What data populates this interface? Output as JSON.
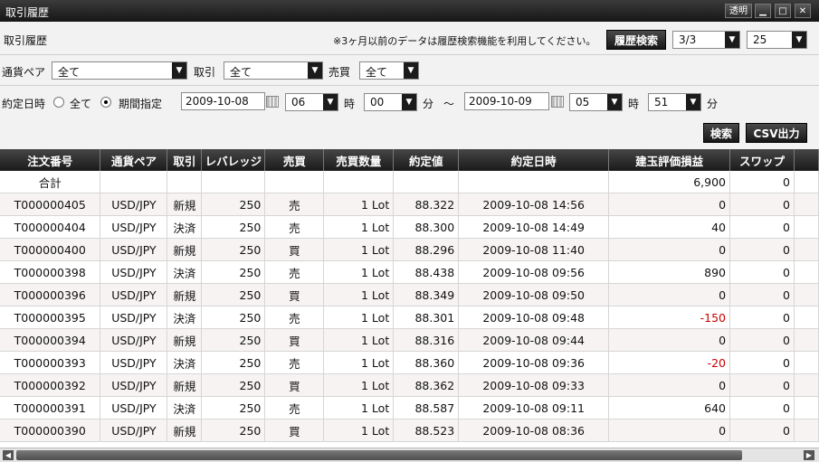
{
  "window": {
    "title": "取引履歴",
    "transparent_label": "透明",
    "minimize": "▁",
    "maximize": "□",
    "close": "✕"
  },
  "header": {
    "panel_title": "取引履歴",
    "note": "※3ヶ月以前のデータは履歴検索機能を利用してください。",
    "history_search_label": "履歴検索",
    "page_value": "3/3",
    "per_page_value": "25"
  },
  "filters": {
    "pair_label": "通貨ペア",
    "pair_value": "全て",
    "trade_label": "取引",
    "trade_value": "全て",
    "side_label": "売買",
    "side_value": "全て"
  },
  "date_filter": {
    "label": "約定日時",
    "opt_all": "全て",
    "opt_range": "期間指定",
    "selected": "期間指定",
    "from_date": "2009-10-08",
    "from_hour": "06",
    "from_min": "00",
    "to_date": "2009-10-09",
    "to_hour": "05",
    "to_min": "51",
    "hour_unit": "時",
    "min_unit": "分",
    "tilde": "～"
  },
  "actions": {
    "search_label": "検索",
    "csv_label": "CSV出力"
  },
  "table": {
    "columns": [
      "注文番号",
      "通貨ペア",
      "取引",
      "レバレッジ",
      "売買",
      "売買数量",
      "約定値",
      "約定日時",
      "建玉評価損益",
      "スワップ"
    ],
    "total_row": {
      "label": "合計",
      "pl": "6,900",
      "swap": "0"
    },
    "rows": [
      {
        "id": "T000000405",
        "pair": "USD/JPY",
        "trade": "新規",
        "lev": "250",
        "side": "売",
        "qty": "1 Lot",
        "price": "88.322",
        "time": "2009-10-08 14:56",
        "pl": "0",
        "swap": "0"
      },
      {
        "id": "T000000404",
        "pair": "USD/JPY",
        "trade": "決済",
        "lev": "250",
        "side": "売",
        "qty": "1 Lot",
        "price": "88.300",
        "time": "2009-10-08 14:49",
        "pl": "40",
        "swap": "0"
      },
      {
        "id": "T000000400",
        "pair": "USD/JPY",
        "trade": "新規",
        "lev": "250",
        "side": "買",
        "qty": "1 Lot",
        "price": "88.296",
        "time": "2009-10-08 11:40",
        "pl": "0",
        "swap": "0"
      },
      {
        "id": "T000000398",
        "pair": "USD/JPY",
        "trade": "決済",
        "lev": "250",
        "side": "売",
        "qty": "1 Lot",
        "price": "88.438",
        "time": "2009-10-08 09:56",
        "pl": "890",
        "swap": "0"
      },
      {
        "id": "T000000396",
        "pair": "USD/JPY",
        "trade": "新規",
        "lev": "250",
        "side": "買",
        "qty": "1 Lot",
        "price": "88.349",
        "time": "2009-10-08 09:50",
        "pl": "0",
        "swap": "0"
      },
      {
        "id": "T000000395",
        "pair": "USD/JPY",
        "trade": "決済",
        "lev": "250",
        "side": "売",
        "qty": "1 Lot",
        "price": "88.301",
        "time": "2009-10-08 09:48",
        "pl": "-150",
        "swap": "0"
      },
      {
        "id": "T000000394",
        "pair": "USD/JPY",
        "trade": "新規",
        "lev": "250",
        "side": "買",
        "qty": "1 Lot",
        "price": "88.316",
        "time": "2009-10-08 09:44",
        "pl": "0",
        "swap": "0"
      },
      {
        "id": "T000000393",
        "pair": "USD/JPY",
        "trade": "決済",
        "lev": "250",
        "side": "売",
        "qty": "1 Lot",
        "price": "88.360",
        "time": "2009-10-08 09:36",
        "pl": "-20",
        "swap": "0"
      },
      {
        "id": "T000000392",
        "pair": "USD/JPY",
        "trade": "新規",
        "lev": "250",
        "side": "買",
        "qty": "1 Lot",
        "price": "88.362",
        "time": "2009-10-08 09:33",
        "pl": "0",
        "swap": "0"
      },
      {
        "id": "T000000391",
        "pair": "USD/JPY",
        "trade": "決済",
        "lev": "250",
        "side": "売",
        "qty": "1 Lot",
        "price": "88.587",
        "time": "2009-10-08 09:11",
        "pl": "640",
        "swap": "0"
      },
      {
        "id": "T000000390",
        "pair": "USD/JPY",
        "trade": "新規",
        "lev": "250",
        "side": "買",
        "qty": "1 Lot",
        "price": "88.523",
        "time": "2009-10-08 08:36",
        "pl": "0",
        "swap": "0"
      }
    ]
  },
  "colors": {
    "negative": "#cc0000",
    "header_bg": "#1a1a1a"
  }
}
